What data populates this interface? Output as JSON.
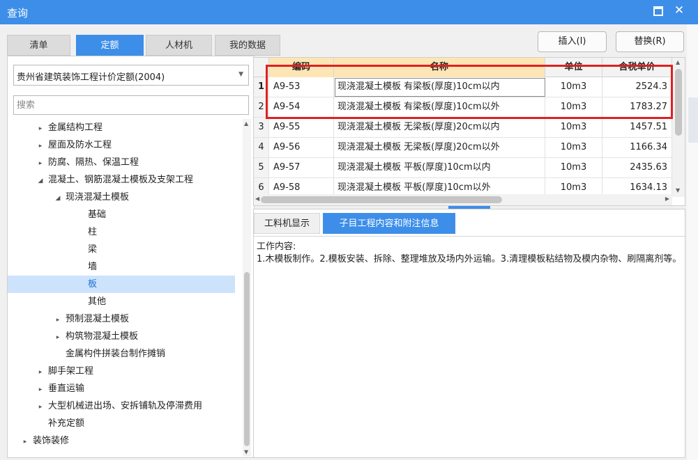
{
  "window": {
    "title": "查询",
    "close_glyph": "✕"
  },
  "tabs": [
    {
      "label": "清单",
      "active": false
    },
    {
      "label": "定额",
      "active": true
    },
    {
      "label": "人材机",
      "active": false
    },
    {
      "label": "我的数据",
      "active": false
    }
  ],
  "buttons": {
    "insert": "插入(I)",
    "replace": "替换(R)"
  },
  "left": {
    "library": "贵州省建筑装饰工程计价定额(2004)",
    "search_placeholder": "搜索",
    "tree": [
      {
        "label": "金属结构工程",
        "level": 1,
        "toggle": "collapsed"
      },
      {
        "label": "屋面及防水工程",
        "level": 1,
        "toggle": "collapsed"
      },
      {
        "label": "防腐、隔热、保温工程",
        "level": 1,
        "toggle": "collapsed"
      },
      {
        "label": "混凝土、钢筋混凝土模板及支架工程",
        "level": 1,
        "toggle": "expanded"
      },
      {
        "label": "现浇混凝土模板",
        "level": 2,
        "toggle": "expanded"
      },
      {
        "label": "基础",
        "level": 3,
        "toggle": "none"
      },
      {
        "label": "柱",
        "level": 3,
        "toggle": "none"
      },
      {
        "label": "梁",
        "level": 3,
        "toggle": "none"
      },
      {
        "label": "墙",
        "level": 3,
        "toggle": "none"
      },
      {
        "label": "板",
        "level": 3,
        "toggle": "none",
        "selected": true
      },
      {
        "label": "其他",
        "level": 3,
        "toggle": "none"
      },
      {
        "label": "预制混凝土模板",
        "level": 2,
        "toggle": "collapsed"
      },
      {
        "label": "构筑物混凝土模板",
        "level": 2,
        "toggle": "collapsed"
      },
      {
        "label": "金属构件拼装台制作摊销",
        "level": 2,
        "toggle": "none"
      },
      {
        "label": "脚手架工程",
        "level": 1,
        "toggle": "collapsed"
      },
      {
        "label": "垂直运输",
        "level": 1,
        "toggle": "collapsed"
      },
      {
        "label": "大型机械进出场、安拆铺轨及停滞费用",
        "level": 1,
        "toggle": "collapsed"
      },
      {
        "label": "补充定额",
        "level": 1,
        "toggle": "none"
      },
      {
        "label": "装饰装修",
        "level": 0,
        "toggle": "collapsed"
      }
    ]
  },
  "grid": {
    "columns": [
      "编码",
      "名称",
      "单位",
      "含税单价"
    ],
    "rows": [
      {
        "n": "1",
        "code": "A9-53",
        "name": "现浇混凝土模板 有梁板(厚度)10cm以内",
        "unit": "10m3",
        "price": "2524.3"
      },
      {
        "n": "2",
        "code": "A9-54",
        "name": "现浇混凝土模板 有梁板(厚度)10cm以外",
        "unit": "10m3",
        "price": "1783.27"
      },
      {
        "n": "3",
        "code": "A9-55",
        "name": "现浇混凝土模板 无梁板(厚度)20cm以内",
        "unit": "10m3",
        "price": "1457.51"
      },
      {
        "n": "4",
        "code": "A9-56",
        "name": "现浇混凝土模板 无梁板(厚度)20cm以外",
        "unit": "10m3",
        "price": "1166.34"
      },
      {
        "n": "5",
        "code": "A9-57",
        "name": "现浇混凝土模板 平板(厚度)10cm以内",
        "unit": "10m3",
        "price": "2435.63"
      },
      {
        "n": "6",
        "code": "A9-58",
        "name": "现浇混凝土模板 平板(厚度)10cm以外",
        "unit": "10m3",
        "price": "1634.13"
      }
    ]
  },
  "bottom": {
    "tabs": [
      {
        "label": "工料机显示",
        "active": false
      },
      {
        "label": "子目工程内容和附注信息",
        "active": true
      }
    ],
    "content_title": "工作内容:",
    "content_body": "1.木模板制作。2.模板安装、拆除、整理堆放及场内外运输。3.清理模板粘结物及模内杂物、刷隔离剂等。"
  },
  "colors": {
    "accent": "#3d8ee8",
    "highlight": "#e02020",
    "header_highlight": "#fde5b5",
    "selected_row": "#cde3fb"
  }
}
